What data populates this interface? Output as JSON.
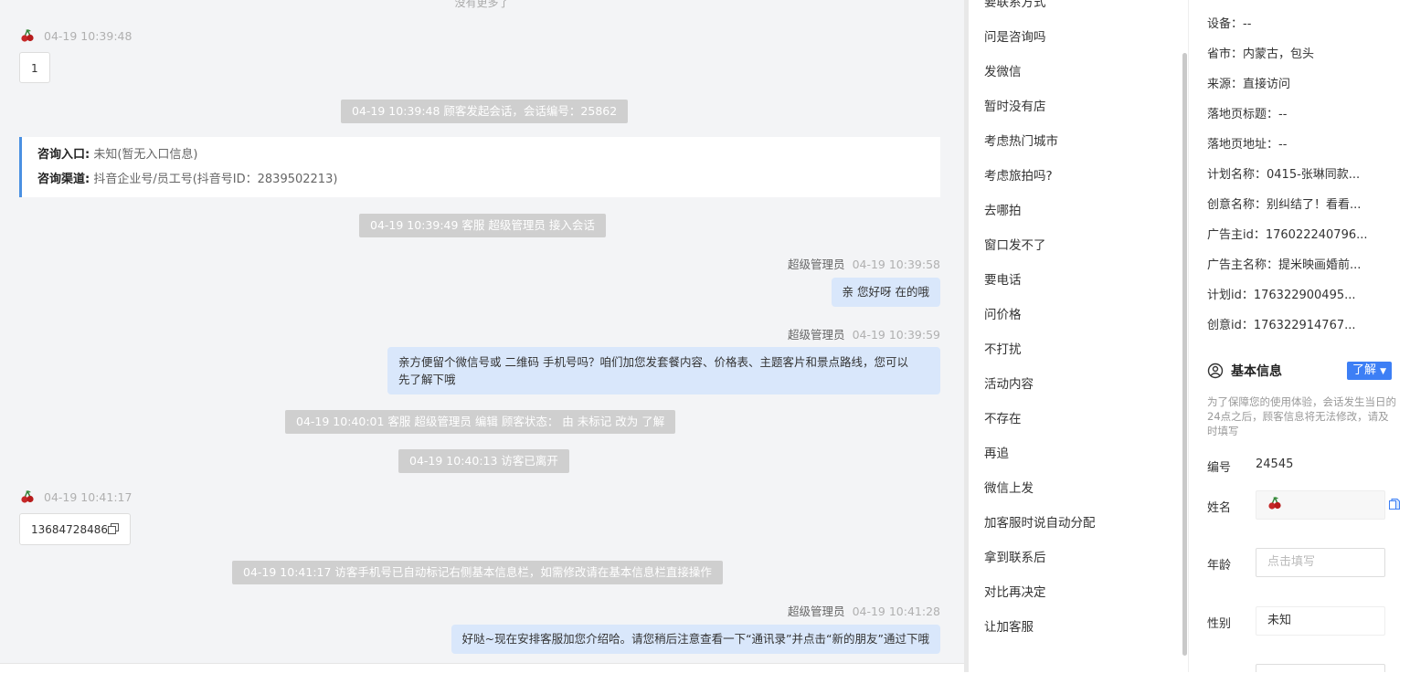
{
  "chat": {
    "no_more": "没有更多了",
    "messages": {
      "v1_time": "04-19 10:39:48",
      "v1_text": "1",
      "sys1": "04-19 10:39:48 顾客发起会话，会话编号：25862",
      "card_entry_label": "咨询入口:",
      "card_entry_value": "未知(暂无入口信息)",
      "card_channel_label": "咨询渠道:",
      "card_channel_value": "抖音企业号/员工号(抖音号ID：2839502213)",
      "sys2": "04-19 10:39:49 客服 超级管理员 接入会话",
      "a1_name": "超级管理员",
      "a1_time": "04-19 10:39:58",
      "a1_text": "亲 您好呀 在的哦",
      "a2_name": "超级管理员",
      "a2_time": "04-19 10:39:59",
      "a2_text_l1": "亲方便留个微信号或 二维码 手机号吗？咱们加您发套餐内容、价格表、主题客片和景点路线，您可以",
      "a2_text_l2": "先了解下哦",
      "sys3": "04-19 10:40:01 客服 超级管理员 编辑 顾客状态： 由 未标记 改为 了解",
      "sys4": "04-19 10:40:13 访客已离开",
      "v2_time": "04-19 10:41:17",
      "v2_text": "13684728486",
      "sys5": "04-19 10:41:17 访客手机号已自动标记右侧基本信息栏，如需修改请在基本信息栏直接操作",
      "a3_name": "超级管理员",
      "a3_time": "04-19 10:41:28",
      "a3_text": "好哒~现在安排客服加您介绍哈。请您稍后注意查看一下“通讯录”并点击“新的朋友”通过下哦"
    }
  },
  "quick_replies": {
    "items": [
      "要联系方式",
      "问是咨询吗",
      "发微信",
      "暂时没有店",
      "考虑热门城市",
      "考虑旅拍吗?",
      "去哪拍",
      "窗口发不了",
      "要电话",
      "问价格",
      "不打扰",
      "活动内容",
      "不存在",
      "再追",
      "微信上发",
      "加客服时说自动分配",
      "拿到联系后",
      "对比再决定",
      "让加客服"
    ]
  },
  "visitor_info": {
    "device": "设备：--",
    "province": "省市：内蒙古，包头",
    "source": "来源：直接访问",
    "landing_title": "落地页标题：--",
    "landing_url": "落地页地址：--",
    "plan_name": "计划名称：0415-张琳同款...",
    "creative_name": "创意名称：别纠结了！看看...",
    "advertiser_id": "广告主id：176022240796...",
    "advertiser_name": "广告主名称：提米映画婚前...",
    "plan_id": "计划id：176322900495...",
    "creative_id": "创意id：176322914767..."
  },
  "basic_info": {
    "title": "基本信息",
    "status_button": "了解",
    "note": "为了保障您的使用体验，会话发生当日的24点之后，顾客信息将无法修改，请及时填写",
    "id_label": "编号",
    "id_value": "24545",
    "name_label": "姓名",
    "age_label": "年龄",
    "age_placeholder": "点击填写",
    "gender_label": "性别",
    "gender_value": "未知"
  },
  "colors": {
    "accent": "#3d7ff5",
    "agent_bubble": "#d9e7fb",
    "system_pill": "#cfcfcf"
  }
}
